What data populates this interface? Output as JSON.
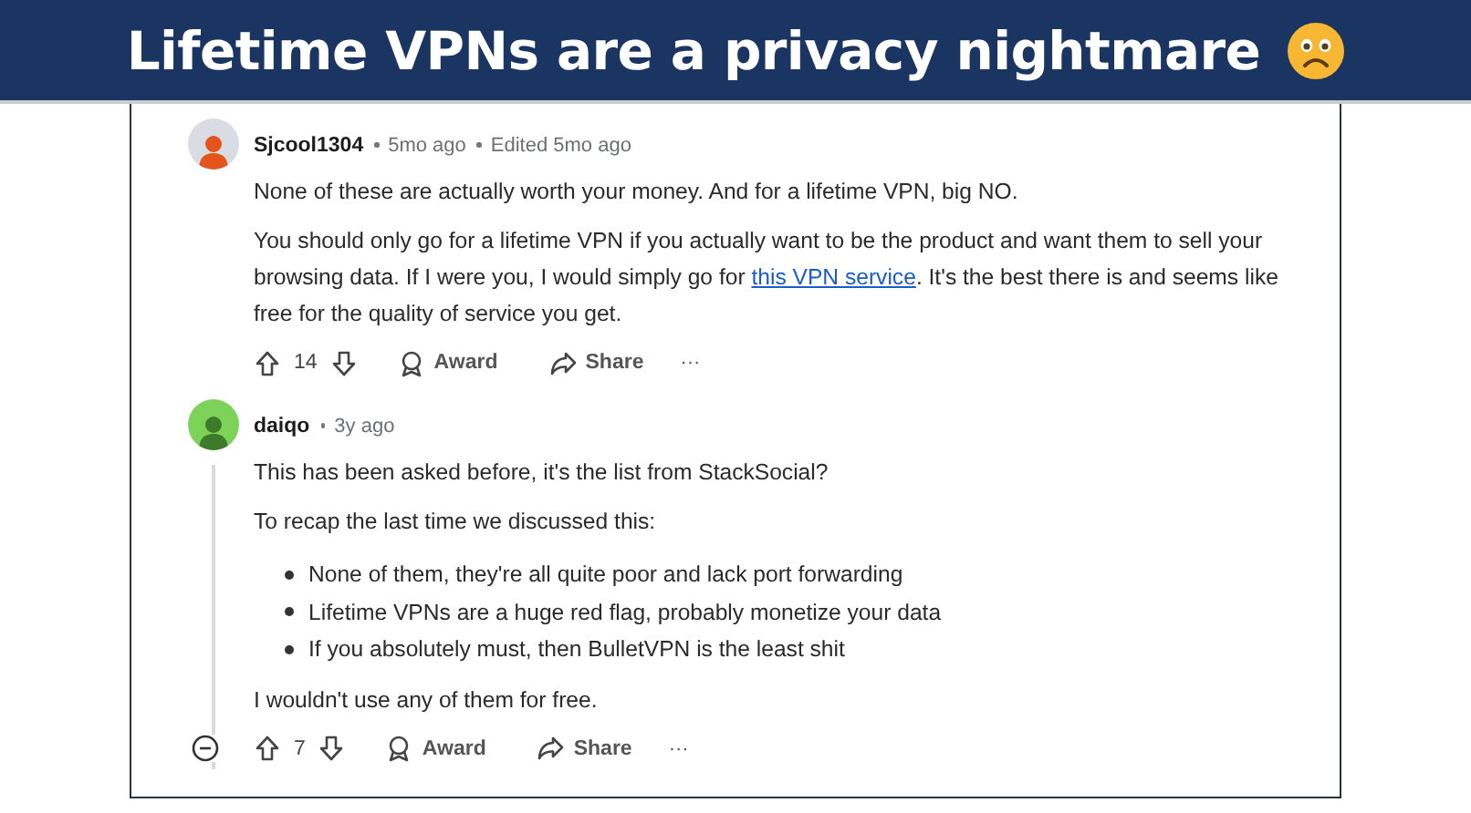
{
  "banner": {
    "title": "Lifetime VPNs are a privacy nightmare"
  },
  "comments": [
    {
      "author": "Sjcool1304",
      "color": "#d9dde3",
      "meta": [
        "5mo ago",
        "Edited 5mo ago"
      ],
      "collapsible": false,
      "blocks": [
        {
          "kind": "paragraph",
          "parts": [
            {
              "kind": "text",
              "text": "None of these are actually worth your money. And for a lifetime VPN, big NO."
            }
          ]
        },
        {
          "kind": "paragraph",
          "parts": [
            {
              "kind": "text",
              "text": "You should only go for a lifetime VPN if you actually want to be the product and want them to sell your browsing data. If I were you, I would simply go for "
            },
            {
              "kind": "link",
              "text": "this VPN service"
            },
            {
              "kind": "text",
              "text": ". It's the best there is and seems like free for the quality of service you get."
            }
          ]
        }
      ],
      "votes": "14",
      "actions": [
        "Award",
        "Share"
      ],
      "more": "···"
    },
    {
      "author": "daiqo",
      "color": "#7dd35a",
      "meta": [
        "3y ago"
      ],
      "collapsible": true,
      "blocks": [
        {
          "kind": "paragraph",
          "parts": [
            {
              "kind": "text",
              "text": "This has been asked before, it's the list from StackSocial?"
            }
          ]
        },
        {
          "kind": "paragraph",
          "parts": [
            {
              "kind": "text",
              "text": "To recap the last time we discussed this:"
            }
          ]
        },
        {
          "kind": "list",
          "items": [
            "None of them, they're all quite poor and lack port forwarding",
            "Lifetime VPNs are a huge red flag, probably monetize your data",
            "If you absolutely must, then BulletVPN is the least shit"
          ]
        },
        {
          "kind": "paragraph",
          "parts": [
            {
              "kind": "text",
              "text": "I wouldn't use any of them for free."
            }
          ]
        }
      ],
      "votes": "7",
      "actions": [
        "Award",
        "Share"
      ],
      "more": "···"
    }
  ]
}
